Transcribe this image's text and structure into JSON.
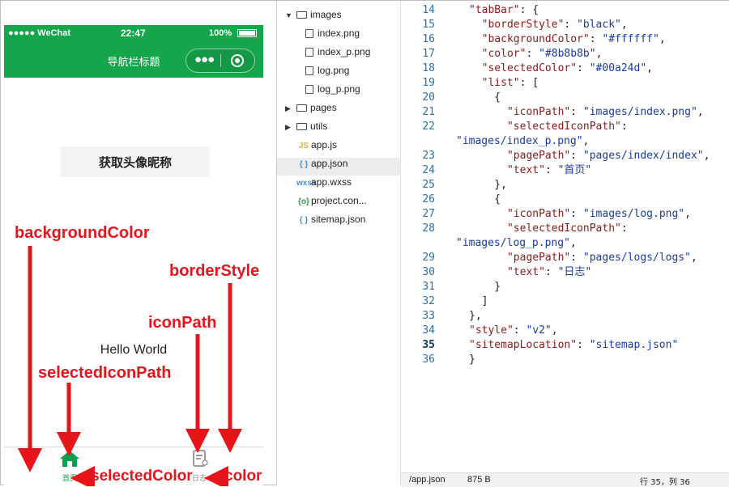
{
  "simulator": {
    "status": {
      "carrier": "●●●●● WeChat",
      "time": "22:47",
      "battery": "100%"
    },
    "navbar_title": "导航栏标题",
    "avatar_button": "获取头像昵称",
    "hello_text": "Hello World",
    "tabs": [
      {
        "label": "首页",
        "icon": "home-icon",
        "selected": true
      },
      {
        "label": "日志",
        "icon": "log-icon",
        "selected": false
      }
    ],
    "colors": {
      "navbar": "#15a54b",
      "selected": "#00a24d",
      "unselected": "#8b8b8b"
    }
  },
  "annotations": {
    "backgroundColor": "backgroundColor",
    "borderStyle": "borderStyle",
    "iconPath": "iconPath",
    "selectedIconPath": "selectedIconPath",
    "selectedColor": "selectedColor",
    "color": "color"
  },
  "file_tree": [
    {
      "name": "images",
      "type": "folder",
      "open": true
    },
    {
      "name": "index.png",
      "type": "image"
    },
    {
      "name": "index_p.png",
      "type": "image"
    },
    {
      "name": "log.png",
      "type": "image"
    },
    {
      "name": "log_p.png",
      "type": "image"
    },
    {
      "name": "pages",
      "type": "folder",
      "open": false
    },
    {
      "name": "utils",
      "type": "folder",
      "open": false
    },
    {
      "name": "app.js",
      "type": "js"
    },
    {
      "name": "app.json",
      "type": "json",
      "selected": true
    },
    {
      "name": "app.wxss",
      "type": "wxss"
    },
    {
      "name": "project.con...",
      "type": "config"
    },
    {
      "name": "sitemap.json",
      "type": "json"
    }
  ],
  "editor": {
    "current_line": 35,
    "lines": [
      {
        "n": "14",
        "text": "\"tabBar\": {"
      },
      {
        "n": "15",
        "text": "  \"borderStyle\": \"black\","
      },
      {
        "n": "16",
        "text": "  \"backgroundColor\": \"#ffffff\","
      },
      {
        "n": "17",
        "text": "  \"color\": \"#8b8b8b\","
      },
      {
        "n": "18",
        "text": "  \"selectedColor\": \"#00a24d\","
      },
      {
        "n": "19",
        "text": "  \"list\": ["
      },
      {
        "n": "20",
        "text": "    {"
      },
      {
        "n": "21",
        "text": "      \"iconPath\": \"images/index.png\","
      },
      {
        "n": "22",
        "text": "      \"selectedIconPath\":"
      },
      {
        "n": "",
        "text": "\"images/index_p.png\",",
        "wrap": true
      },
      {
        "n": "23",
        "text": "      \"pagePath\": \"pages/index/index\","
      },
      {
        "n": "24",
        "text": "      \"text\": \"首页\""
      },
      {
        "n": "25",
        "text": "    },"
      },
      {
        "n": "26",
        "text": "    {"
      },
      {
        "n": "27",
        "text": "      \"iconPath\": \"images/log.png\","
      },
      {
        "n": "28",
        "text": "      \"selectedIconPath\":"
      },
      {
        "n": "",
        "text": "\"images/log_p.png\",",
        "wrap": true
      },
      {
        "n": "29",
        "text": "      \"pagePath\": \"pages/logs/logs\","
      },
      {
        "n": "30",
        "text": "      \"text\": \"日志\""
      },
      {
        "n": "31",
        "text": "    }"
      },
      {
        "n": "32",
        "text": "  ]"
      },
      {
        "n": "33",
        "text": "},"
      },
      {
        "n": "34",
        "text": "\"style\": \"v2\","
      },
      {
        "n": "35",
        "text": "\"sitemapLocation\": \"sitemap.json\""
      },
      {
        "n": "36",
        "text": "}"
      }
    ]
  },
  "statusbar": {
    "path": "/app.json",
    "size": "875 B",
    "position": "行 35，列 36"
  }
}
